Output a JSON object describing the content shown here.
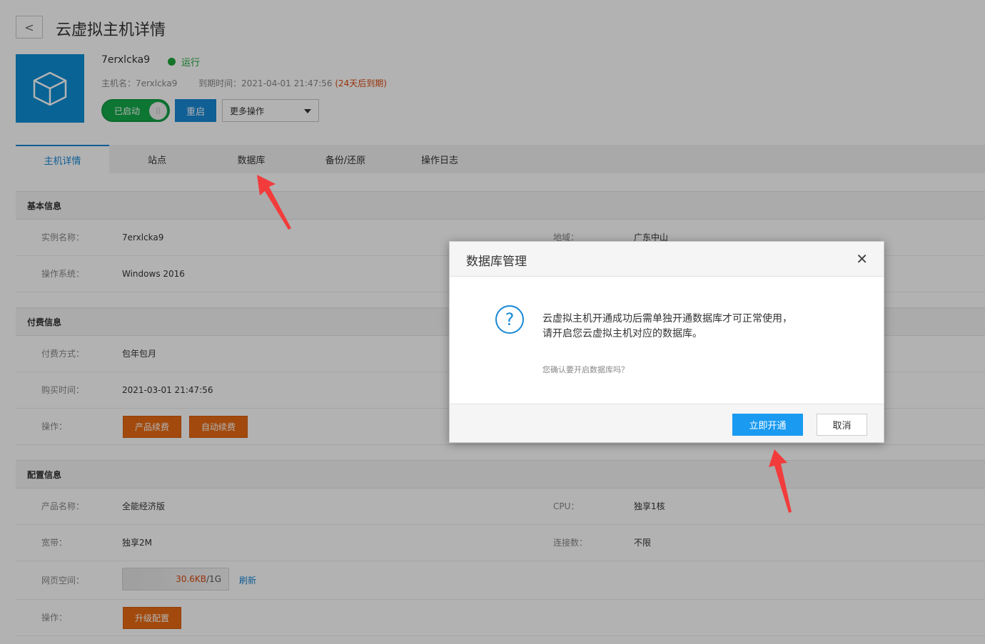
{
  "header": {
    "back_label": "<",
    "title": "云虚拟主机详情"
  },
  "host": {
    "name": "7erxlcka9",
    "status": "运行",
    "hostname_label": "主机名：",
    "hostname": "7erxlcka9",
    "expiry_label": "到期时间：",
    "expiry": "2021-04-01 21:47:56",
    "expiry_note": "(24天后到期)",
    "toggle_label": "已启动",
    "toggle_knob": "||",
    "restart_label": "重启",
    "more_label": "更多操作"
  },
  "tabs": [
    {
      "label": "主机详情"
    },
    {
      "label": "站点"
    },
    {
      "label": "数据库"
    },
    {
      "label": "备份/还原"
    },
    {
      "label": "操作日志"
    }
  ],
  "basic": {
    "title": "基本信息",
    "instance_label": "实例名称：",
    "instance": "7erxlcka9",
    "region_label": "地域：",
    "region": "广东中山",
    "os_label": "操作系统：",
    "os": "Windows 2016"
  },
  "billing": {
    "title": "付费信息",
    "method_label": "付费方式：",
    "method": "包年包月",
    "purchase_label": "购买时间：",
    "purchase": "2021-03-01 21:47:56",
    "ops_label": "操作：",
    "renew_label": "产品续费",
    "auto_renew_label": "自动续费"
  },
  "config": {
    "title": "配置信息",
    "product_label": "产品名称：",
    "product": "全能经济版",
    "cpu_label": "CPU：",
    "cpu": "独享1核",
    "bandwidth_label": "宽带：",
    "bandwidth": "独享2M",
    "connections_label": "连接数：",
    "connections": "不限",
    "space_label": "网页空间：",
    "space_used": "30.6KB",
    "space_total": "/1G",
    "refresh_label": "刷新",
    "ops_label": "操作：",
    "upgrade_label": "升级配置"
  },
  "modal": {
    "title": "数据库管理",
    "close": "✕",
    "icon": "question-icon",
    "message_line1": "云虚拟主机开通成功后需单独开通数据库才可正常使用，",
    "message_line2": "请开启您云虚拟主机对应的数据库。",
    "confirm": "您确认要开启数据库吗？",
    "ok_label": "立即开通",
    "cancel_label": "取消"
  },
  "colors": {
    "primary": "#1788d6",
    "success": "#14a94a",
    "warning": "#e86a14",
    "annotation": "#f23c3c"
  }
}
